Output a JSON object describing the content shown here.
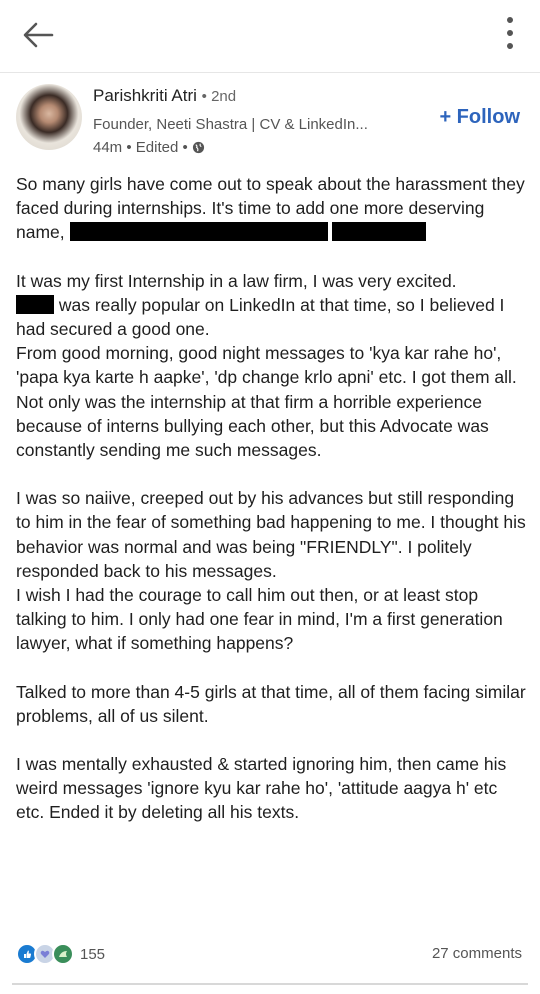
{
  "header": {
    "back_icon": "arrow-left-icon",
    "menu_icon": "more-vertical-icon"
  },
  "author": {
    "name": "Parishkriti Atri",
    "degree": "• 2nd",
    "headline": "Founder, Neeti Shastra | CV & LinkedIn...",
    "time": "44m • Edited •",
    "visibility_icon": "globe-icon",
    "follow_label": "+ Follow"
  },
  "post": {
    "p1_a": "So many girls have come out to speak about the harassment they faced during internships. It's time to add one more deserving name,",
    "p2_a": "It was my first Internship in a law firm, I was very excited.",
    "p2_b": "was really popular on LinkedIn at that time, so I believed I had secured a good one.",
    "p2_c": "From good morning, good night messages to 'kya kar rahe ho', 'papa kya karte h aapke', 'dp change krlo apni' etc. I got them all.",
    "p2_d": "Not only was the internship at that firm a horrible experience because of interns bullying each other, but this Advocate was constantly sending me such messages.",
    "p3_a": "I was so naiive, creeped out by his advances but still responding to him in the fear of something bad happening to me. I thought his behavior was normal and was being \"FRIENDLY\". I politely responded back to his messages.",
    "p3_b": "I wish I had the courage to call him out then, or at least stop talking to him. I only had one fear in mind, I'm a first generation lawyer, what if something happens?",
    "p4": "Talked to more than 4-5 girls at that time, all of them facing similar problems, all of us silent.",
    "p5": "I was mentally exhausted & started ignoring him, then came his weird messages 'ignore kyu kar rahe ho', 'attitude aagya h' etc etc. Ended it by deleting all his texts."
  },
  "footer": {
    "reaction_icons": [
      "like-icon",
      "love-icon",
      "support-icon"
    ],
    "reaction_count": "155",
    "comments": "27 comments"
  }
}
